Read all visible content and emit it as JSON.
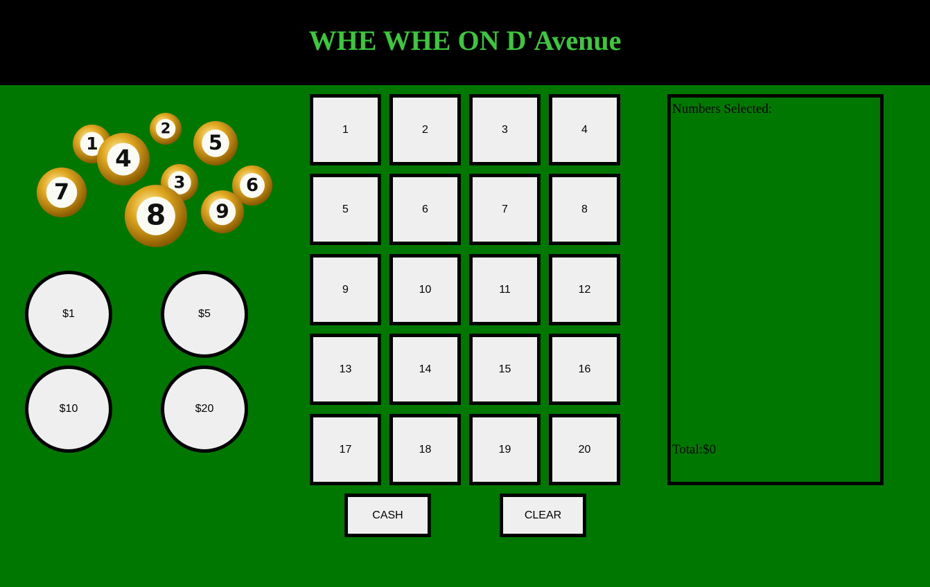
{
  "header": {
    "title": "WHE WHE ON D'Avenue"
  },
  "balls_image": {
    "balls": [
      "1",
      "4",
      "2",
      "5",
      "7",
      "3",
      "6",
      "8",
      "9"
    ],
    "color": "#d4a017"
  },
  "chips": [
    {
      "label": "$1"
    },
    {
      "label": "$5"
    },
    {
      "label": "$10"
    },
    {
      "label": "$20"
    }
  ],
  "numbers": [
    "1",
    "2",
    "3",
    "4",
    "5",
    "6",
    "7",
    "8",
    "9",
    "10",
    "11",
    "12",
    "13",
    "14",
    "15",
    "16",
    "17",
    "18",
    "19",
    "20"
  ],
  "actions": {
    "cash_label": "CASH",
    "clear_label": "CLEAR"
  },
  "selection_panel": {
    "heading": "Numbers Selected:",
    "total_label": "Total:",
    "total_value": "$0"
  },
  "colors": {
    "background": "#007800",
    "header_bg": "#000000",
    "title": "#3cc83c",
    "button_bg": "#efefef"
  }
}
